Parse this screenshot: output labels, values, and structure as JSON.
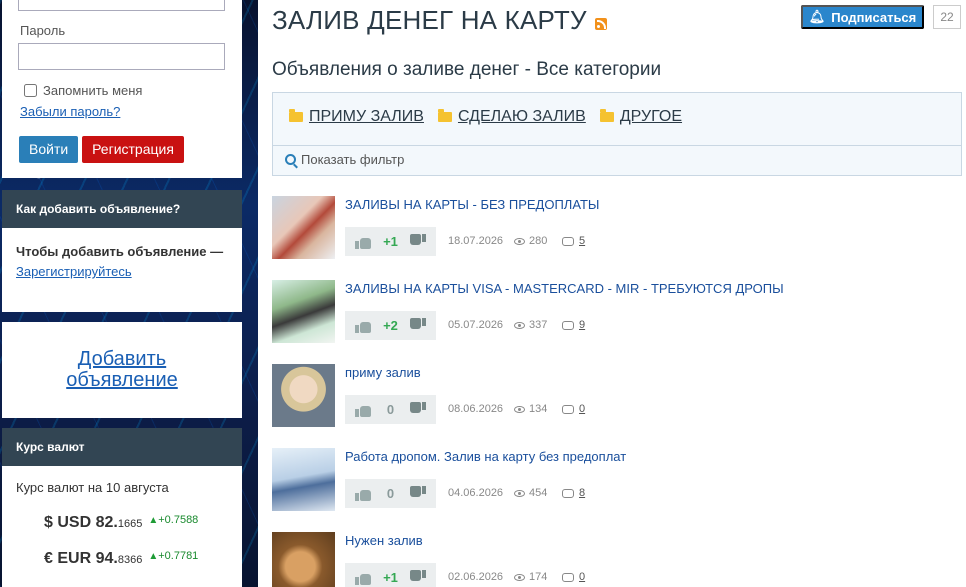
{
  "sidebar": {
    "login": {
      "password_label": "Пароль",
      "remember_label": "Запомнить меня",
      "forgot_label": "Забыли пароль?",
      "login_button": "Войти",
      "register_button": "Регистрация"
    },
    "howto": {
      "title": "Как добавить объявление?",
      "text": "Чтобы добавить объявление —",
      "link": "Зарегистрируйтесь"
    },
    "add_link": "Добавить объявление",
    "rates": {
      "title": "Курс валют",
      "date_text": "Курс валют на 10 августа",
      "items": [
        {
          "symbol": "$",
          "code": "USD",
          "int": "82.",
          "frac": "1665",
          "change": "+0.7588"
        },
        {
          "symbol": "€",
          "code": "EUR",
          "int": "94.",
          "frac": "8366",
          "change": "+0.7781"
        }
      ]
    }
  },
  "header": {
    "title": "ЗАЛИВ ДЕНЕГ НА КАРТУ",
    "subscribe_label": "Подписаться",
    "subscribe_count": "22"
  },
  "section_title": "Объявления о заливе денег - Все категории",
  "categories": [
    "ПРИМУ ЗАЛИВ",
    "СДЕЛАЮ ЗАЛИВ",
    "ДРУГОЕ"
  ],
  "filter_label": "Показать фильтр",
  "ads": [
    {
      "title": "ЗАЛИВЫ НА КАРТЫ - БЕЗ ПРЕДОПЛАТЫ",
      "rating": "+1",
      "date": "18.07.2026",
      "views": "280",
      "comments": "5"
    },
    {
      "title": "ЗАЛИВЫ НА КАРТЫ VISA - MASTERCARD - MIR - ТРЕБУЮТСЯ ДРОПЫ",
      "rating": "+2",
      "date": "05.07.2026",
      "views": "337",
      "comments": "9"
    },
    {
      "title": "приму залив",
      "rating": "0",
      "date": "08.06.2026",
      "views": "134",
      "comments": "0"
    },
    {
      "title": "Работа дропом. Залив на карту без предоплат",
      "rating": "0",
      "date": "04.06.2026",
      "views": "454",
      "comments": "8"
    },
    {
      "title": "Нужен залив",
      "rating": "+1",
      "date": "02.06.2026",
      "views": "174",
      "comments": "0"
    }
  ],
  "colors": {
    "accent": "#2a86cc",
    "register": "#c91111",
    "panel_header": "#324553",
    "positive": "#34a853"
  }
}
